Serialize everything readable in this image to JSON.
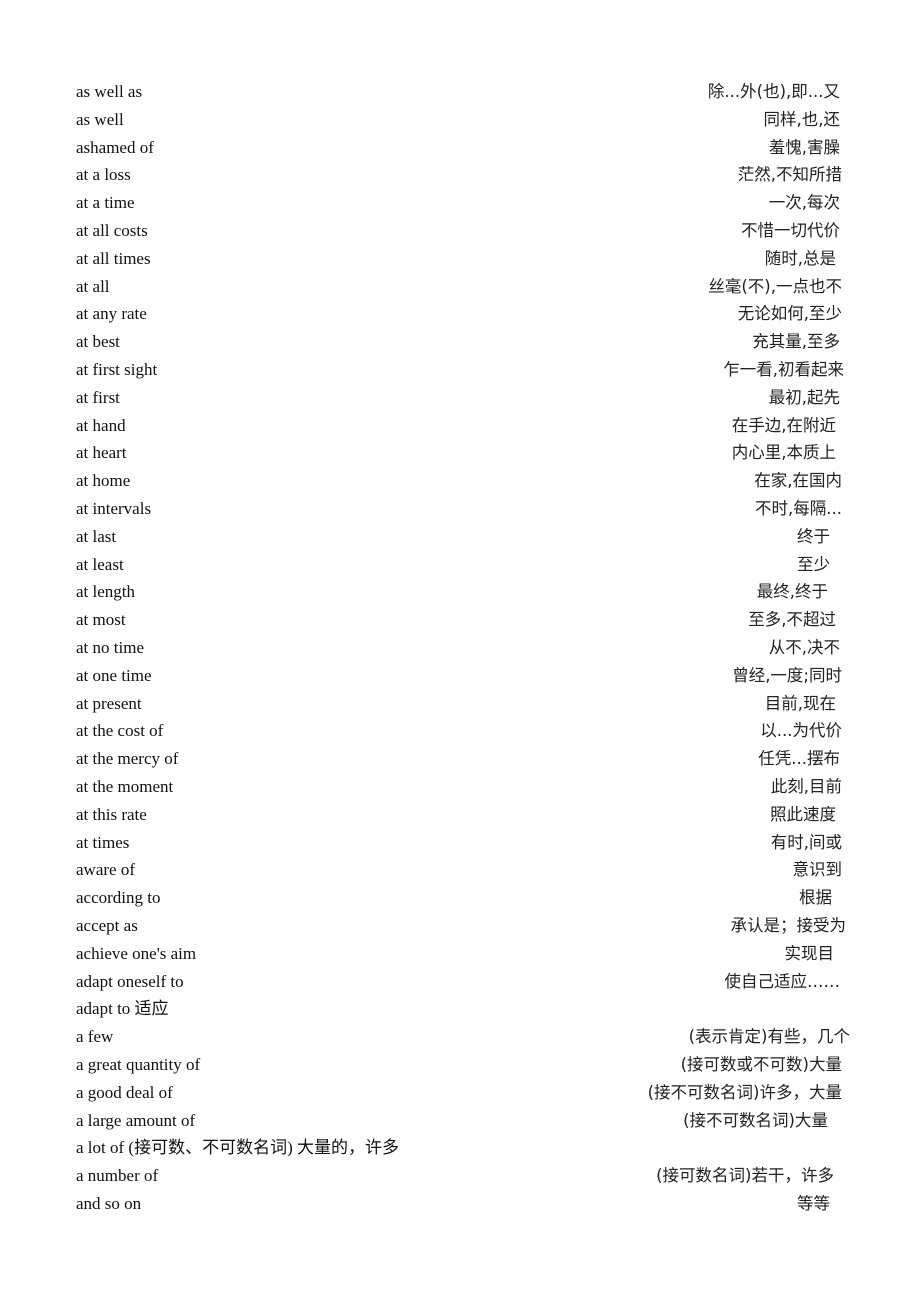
{
  "document": {
    "entries": [
      {
        "phrase": "as well as",
        "meaning": "除...外(也),即...又"
      },
      {
        "phrase": "as well",
        "meaning": "同样,也,还"
      },
      {
        "phrase": "ashamed of",
        "meaning": "羞愧,害臊"
      },
      {
        "phrase": "at a loss",
        "meaning": "茫然,不知所措"
      },
      {
        "phrase": "at a time",
        "meaning": "一次,每次"
      },
      {
        "phrase": "at all costs",
        "meaning": "不惜一切代价"
      },
      {
        "phrase": "at all times",
        "meaning": "随时,总是"
      },
      {
        "phrase": "at all",
        "meaning": "丝毫(不),一点也不"
      },
      {
        "phrase": "at any rate",
        "meaning": "无论如何,至少"
      },
      {
        "phrase": "at best",
        "meaning": "充其量,至多"
      },
      {
        "phrase": "at first sight",
        "meaning": "乍一看,初看起来"
      },
      {
        "phrase": "at first",
        "meaning": "最初,起先"
      },
      {
        "phrase": "at hand",
        "meaning": "在手边,在附近"
      },
      {
        "phrase": "at heart",
        "meaning": "内心里,本质上"
      },
      {
        "phrase": "at home",
        "meaning": "在家,在国内"
      },
      {
        "phrase": "at intervals",
        "meaning": "不时,每隔..."
      },
      {
        "phrase": "at last",
        "meaning": "终于"
      },
      {
        "phrase": "at least",
        "meaning": "至少"
      },
      {
        "phrase": "at length",
        "meaning": "最终,终于"
      },
      {
        "phrase": "at most",
        "meaning": "至多,不超过"
      },
      {
        "phrase": "at no time",
        "meaning": "从不,决不"
      },
      {
        "phrase": "at one time",
        "meaning": "曾经,一度;同时"
      },
      {
        "phrase": "at present",
        "meaning": "目前,现在"
      },
      {
        "phrase": "at the cost of",
        "meaning": "以...为代价"
      },
      {
        "phrase": "at the mercy of",
        "meaning": "任凭...摆布"
      },
      {
        "phrase": "at the moment",
        "meaning": "此刻,目前"
      },
      {
        "phrase": "at this rate",
        "meaning": "照此速度"
      },
      {
        "phrase": "at times",
        "meaning": "有时,间或"
      },
      {
        "phrase": "aware of",
        "meaning": "意识到"
      },
      {
        "phrase": "according to",
        "meaning": "根据"
      },
      {
        "phrase": "accept as",
        "meaning": "承认是；接受为"
      },
      {
        "phrase": "achieve one's aim",
        "meaning": "实现目"
      },
      {
        "phrase": "adapt oneself to",
        "meaning": "使自己适应……"
      },
      {
        "phrase": "adapt to  适应",
        "meaning": ""
      },
      {
        "phrase": "a few",
        "meaning": "(表示肯定)有些，几个"
      },
      {
        "phrase": "a great quantity of",
        "meaning": "(接可数或不可数)大量"
      },
      {
        "phrase": "a good deal of",
        "meaning": "(接不可数名词)许多，大量"
      },
      {
        "phrase": "a large amount of",
        "meaning": "(接不可数名词)大量"
      },
      {
        "phrase": "a lot of (接可数、不可数名词)  大量的，许多",
        "meaning": ""
      },
      {
        "phrase": "a number of",
        "meaning": "(接可数名词)若干，许多"
      },
      {
        "phrase": "and so on",
        "meaning": "等等"
      }
    ]
  }
}
